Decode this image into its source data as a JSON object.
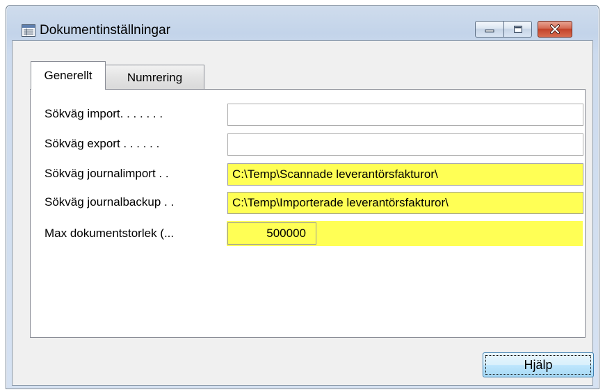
{
  "window": {
    "title": "Dokumentinställningar",
    "icon": "window-icon"
  },
  "tabs": [
    {
      "label": "Generellt",
      "active": true
    },
    {
      "label": "Numrering",
      "active": false
    }
  ],
  "fields": [
    {
      "label": "Sökväg import. . . . . . .",
      "value": "",
      "highlighted": false
    },
    {
      "label": "Sökväg export . . . . . .",
      "value": "",
      "highlighted": false
    },
    {
      "label": "Sökväg journalimport . .",
      "value": "C:\\Temp\\Scannade leverantörsfakturor\\",
      "highlighted": true
    },
    {
      "label": "Sökväg journalbackup . .",
      "value": "C:\\Temp\\Importerade leverantörsfakturor\\",
      "highlighted": true
    },
    {
      "label": "Max dokumentstorlek (...",
      "value": "500000",
      "highlighted": true
    }
  ],
  "buttons": {
    "help_label": "Hjälp"
  },
  "colors": {
    "highlight": "#ffff55",
    "close_button": "#c2432a"
  }
}
